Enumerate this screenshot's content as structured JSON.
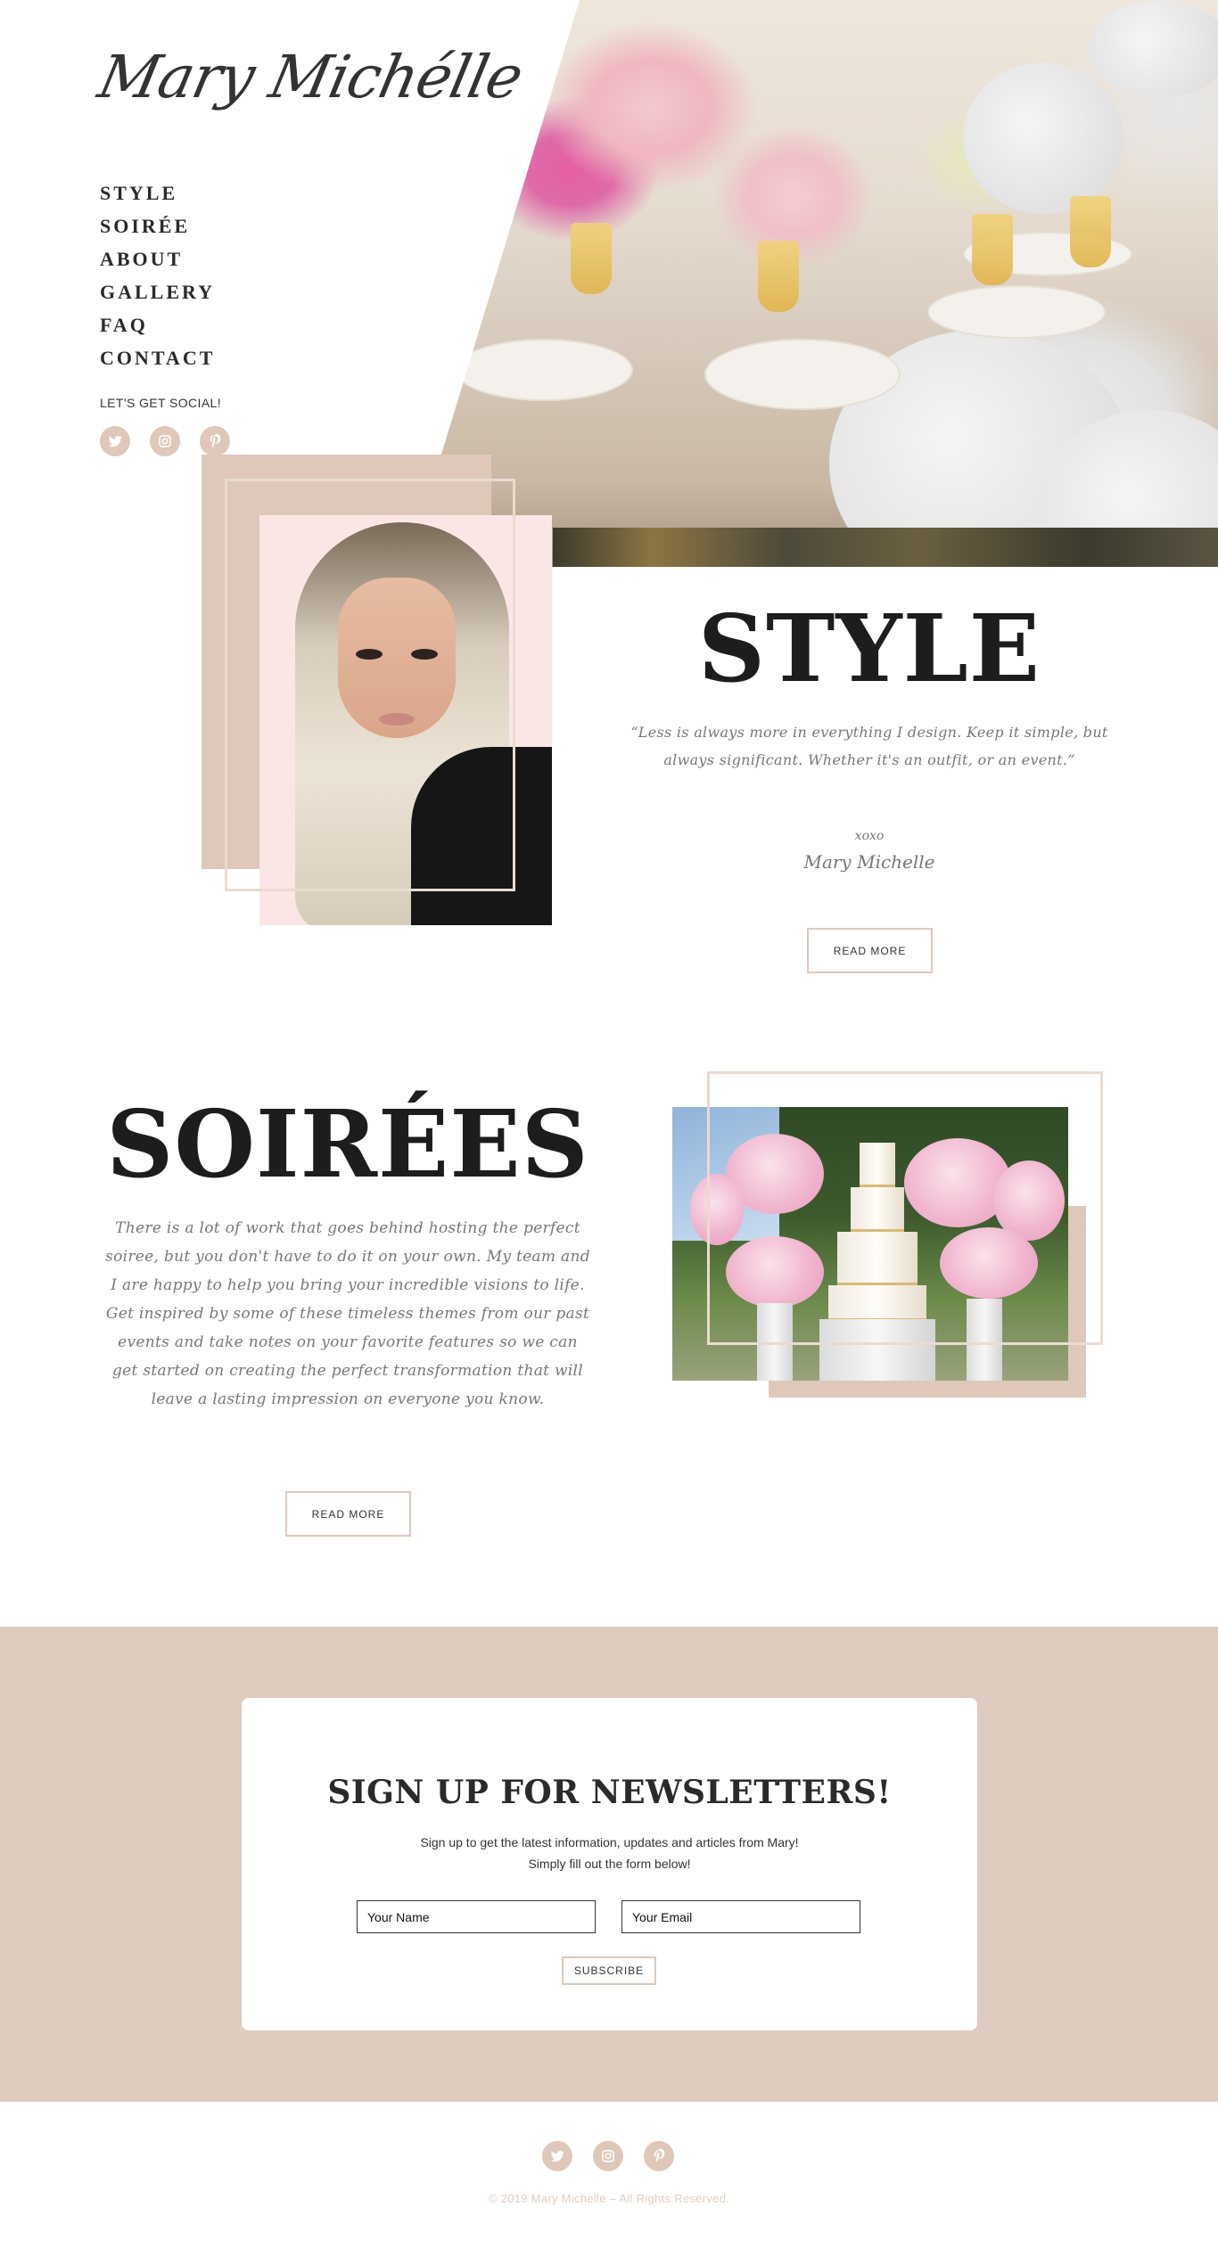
{
  "site": {
    "logo": "Mary Michélle",
    "nav": [
      "STYLE",
      "SOIRÉE",
      "ABOUT",
      "GALLERY",
      "FAQ",
      "CONTACT"
    ],
    "social_label": "LET'S GET SOCIAL!",
    "social_icons": [
      "twitter-icon",
      "instagram-icon",
      "pinterest-icon"
    ]
  },
  "style_section": {
    "heading": "STYLE",
    "quote": "“Less is always more in everything I design. Keep it simple, but always significant. Whether it's an outfit, or an event.”",
    "xoxo": "xoxo",
    "signoff": "Mary Michelle",
    "button": "READ MORE"
  },
  "soirees_section": {
    "heading": "SOIRÉES",
    "text": "There is a lot of work that goes behind hosting the perfect soiree, but you don't have to do it on your own. My team and I are happy to help you bring your incredible visions to life. Get inspired by some of these timeless themes from our past events and take notes on your favorite features so we can get started on creating the perfect transformation that will leave a lasting impression on everyone you know.",
    "button": "READ MORE"
  },
  "newsletter": {
    "title": "SIGN UP FOR NEWSLETTERS!",
    "subtitle_line1": "Sign up to get the latest information, updates and articles from Mary!",
    "subtitle_line2": "Simply fill out the form below!",
    "name_placeholder": "Your Name",
    "email_placeholder": "Your Email",
    "button": "SUBSCRIBE"
  },
  "footer": {
    "copyright": "© 2019 Mary Michelle – All Rights Reserved."
  },
  "colors": {
    "accent": "#dfc8b9",
    "band": "#dfccbe",
    "text": "#222222",
    "script": "#777777"
  }
}
